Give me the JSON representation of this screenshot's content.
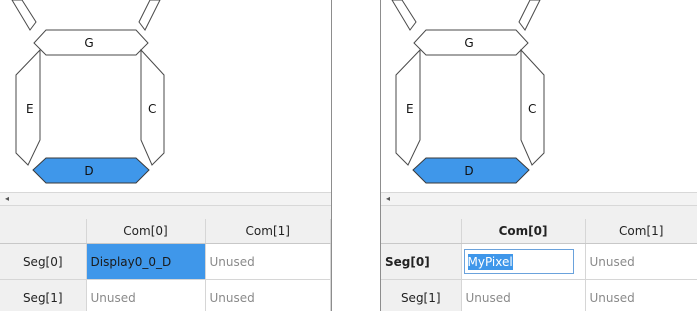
{
  "colors": {
    "selection": "#3f97ea",
    "segment_fill_active": "#3f97ea",
    "segment_stroke": "#4a4a4a"
  },
  "left_panel": {
    "segments": {
      "top_label": "G",
      "left_label": "E",
      "right_label": "C",
      "bottom_label": "D"
    },
    "active_segment": "D",
    "scroll_arrow": "◂",
    "grid": {
      "columns": [
        "Com[0]",
        "Com[1]"
      ],
      "rows": [
        {
          "header": "Seg[0]",
          "cells": [
            "Display0_0_D",
            "Unused"
          ]
        },
        {
          "header": "Seg[1]",
          "cells": [
            "Unused",
            "Unused"
          ]
        }
      ]
    }
  },
  "right_panel": {
    "segments": {
      "top_label": "G",
      "left_label": "E",
      "right_label": "C",
      "bottom_label": "D"
    },
    "active_segment": "D",
    "scroll_arrow": "◂",
    "grid": {
      "columns": [
        "Com[0]",
        "Com[1]"
      ],
      "rows": [
        {
          "header": "Seg[0]",
          "cells": [
            "MyPixel",
            "Unused"
          ]
        },
        {
          "header": "Seg[1]",
          "cells": [
            "Unused",
            "Unused"
          ]
        }
      ]
    }
  }
}
